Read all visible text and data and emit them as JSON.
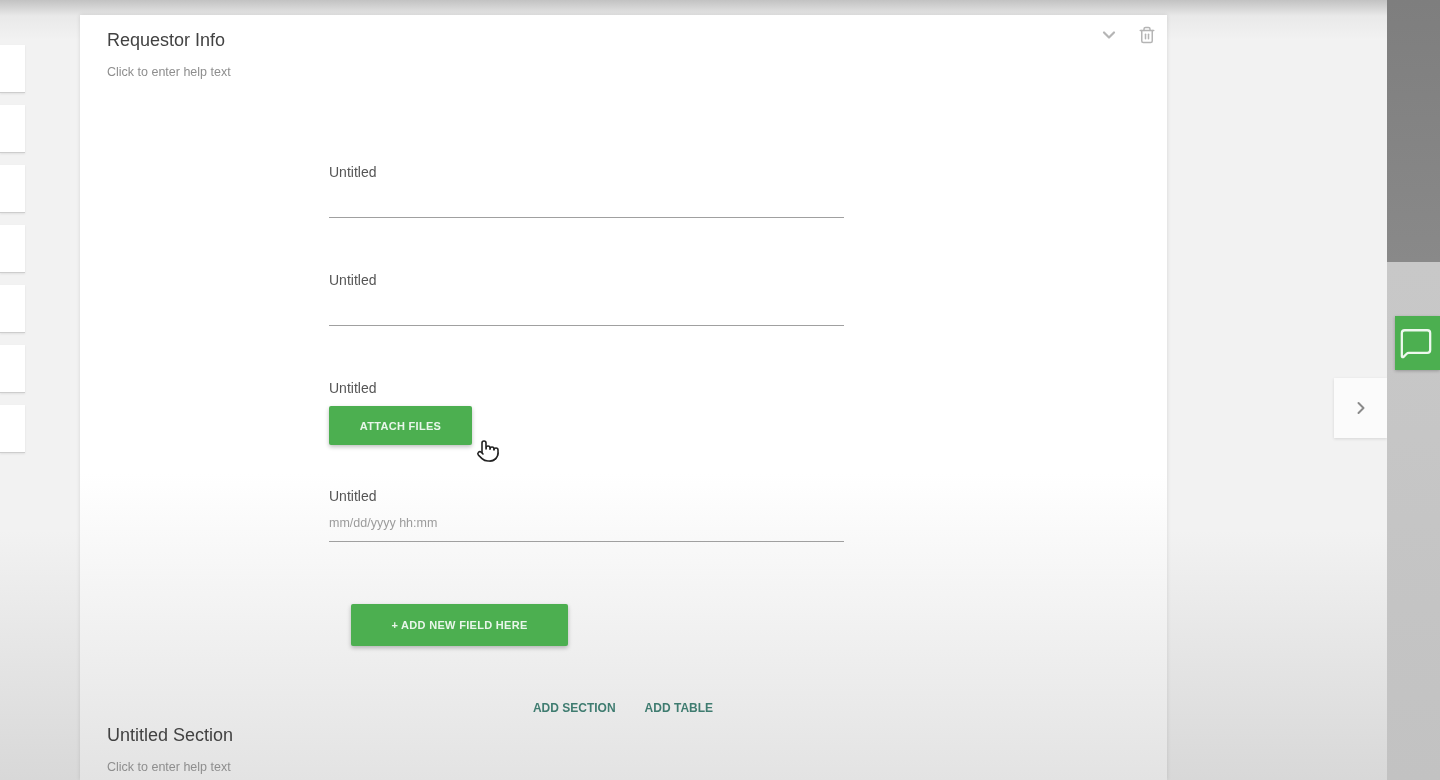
{
  "sections": [
    {
      "title": "Requestor Info",
      "help_text": "Click to enter help text",
      "hovered": true,
      "fields": [
        {
          "kind": "text",
          "label": "Untitled"
        },
        {
          "kind": "text",
          "label": "Untitled"
        },
        {
          "kind": "file",
          "label": "Untitled",
          "button": "ATTACH FILES"
        },
        {
          "kind": "datetime",
          "label": "Untitled",
          "placeholder": "mm/dd/yyyy hh:mm"
        }
      ],
      "add_field_button": "+ ADD NEW FIELD HERE",
      "actions": [
        "ADD SECTION",
        "ADD TABLE"
      ]
    },
    {
      "title": "Untitled Section",
      "help_text": "Click to enter help text",
      "hovered": false
    }
  ]
}
